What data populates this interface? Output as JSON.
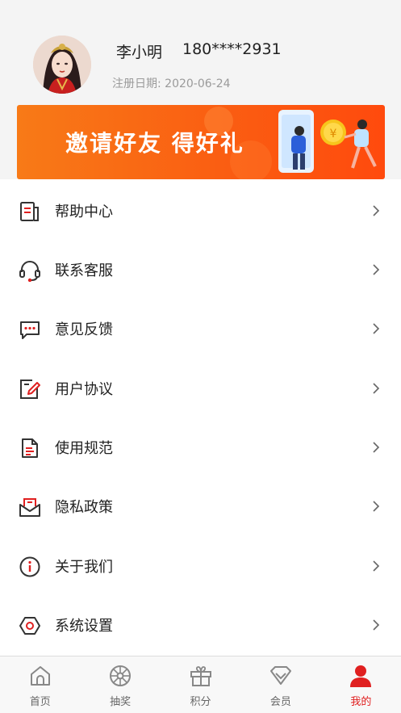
{
  "user": {
    "name": "李小明",
    "phone": "180****2931",
    "register_date": "注册日期: 2020-06-24"
  },
  "banner": {
    "text": "邀请好友 得好礼",
    "coin_symbol": "¥"
  },
  "menu": {
    "items": [
      {
        "label": "帮助中心",
        "icon": "help-center-icon"
      },
      {
        "label": "联系客服",
        "icon": "headset-icon"
      },
      {
        "label": "意见反馈",
        "icon": "feedback-icon"
      },
      {
        "label": "用户协议",
        "icon": "agreement-icon"
      },
      {
        "label": "使用规范",
        "icon": "document-icon"
      },
      {
        "label": "隐私政策",
        "icon": "privacy-envelope-icon"
      },
      {
        "label": "关于我们",
        "icon": "info-icon"
      },
      {
        "label": "系统设置",
        "icon": "settings-hex-icon"
      }
    ]
  },
  "tabbar": {
    "tabs": [
      {
        "label": "首页",
        "icon": "home-icon"
      },
      {
        "label": "抽奖",
        "icon": "lottery-wheel-icon"
      },
      {
        "label": "积分",
        "icon": "gift-icon"
      },
      {
        "label": "会员",
        "icon": "member-diamond-icon"
      },
      {
        "label": "我的",
        "icon": "profile-icon"
      }
    ],
    "active_index": 4
  },
  "colors": {
    "accent": "#e02020",
    "banner_start": "#f87a17",
    "banner_end": "#ff4a0d",
    "icon_dark": "#333333"
  }
}
